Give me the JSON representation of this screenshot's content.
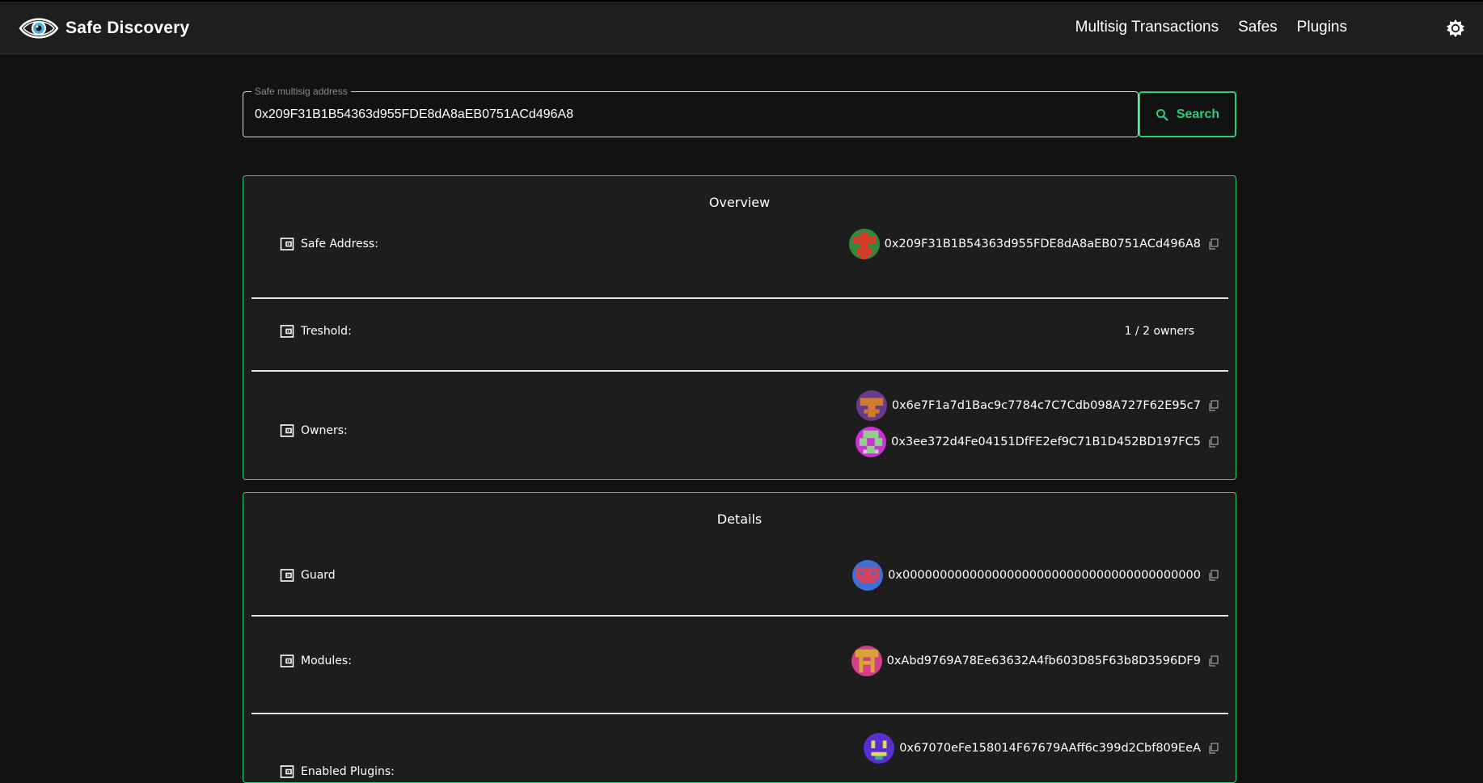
{
  "header": {
    "title": "Safe Discovery",
    "nav": [
      "Multisig Transactions",
      "Safes",
      "Plugins"
    ]
  },
  "search": {
    "label": "Safe multisig address",
    "value": "0x209F31B1B54363d955FDE8dA8aEB0751ACd496A8",
    "button_label": "Search"
  },
  "overview": {
    "title": "Overview",
    "safe_address_label": "Safe Address:",
    "safe_address": "0x209F31B1B54363d955FDE8dA8aEB0751ACd496A8",
    "threshold_label": "Treshold:",
    "threshold_value": "1 / 2 owners",
    "owners_label": "Owners:",
    "owners": [
      "0x6e7F1a7d1Bac9c7784c7C7Cdb098A727F62E95c7",
      "0x3ee372d4Fe04151DfFE2ef9C71B1D452BD197FC5"
    ]
  },
  "details": {
    "title": "Details",
    "guard_label": "Guard",
    "guard": "0x0000000000000000000000000000000000000000",
    "modules_label": "Modules:",
    "module": "0xAbd9769A78Ee63632A4fb603D85F63b8D3596DF9",
    "plugins_label": "Enabled Plugins:",
    "plugin": "0x67070eFe158014F67679AAff6c399d2Cbf809EeA"
  },
  "colors": {
    "accent": "#27d07a",
    "background": "#121212",
    "card": "#1d1d1d"
  },
  "icons": {
    "logo": "eye-logo-icon",
    "theme": "brightness-icon",
    "search": "search-icon",
    "row": "wallet-icon",
    "copy": "copy-icon"
  }
}
